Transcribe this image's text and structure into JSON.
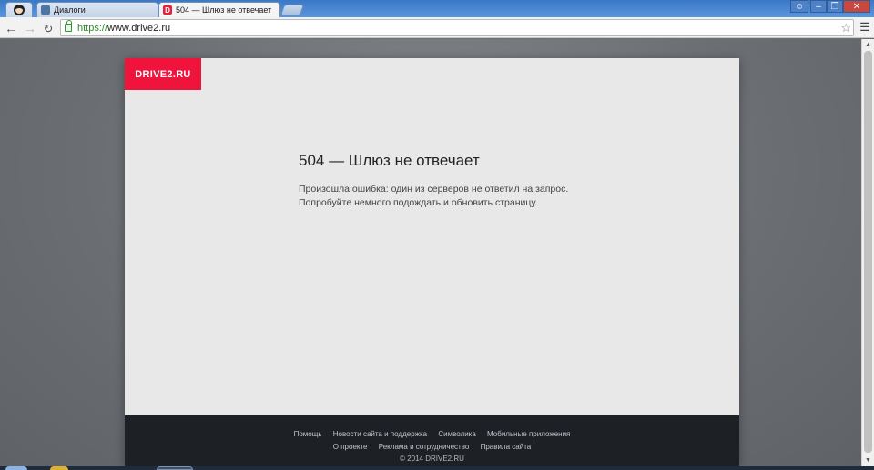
{
  "browser": {
    "tabs": [
      {
        "label": "Диалоги",
        "favicon": "vk-icon",
        "active": false
      },
      {
        "label": "504 — Шлюз не отвечает",
        "favicon": "drive2-icon",
        "active": true
      }
    ],
    "url": {
      "scheme": "https://",
      "host": "www.drive2.ru"
    }
  },
  "page": {
    "logo": "DRIVE2.RU",
    "error_title": "504 — Шлюз не отвечает",
    "error_line1": "Произошла ошибка: один из серверов не ответил на запрос.",
    "error_line2": "Попробуйте немного подождать и обновить страницу.",
    "footer": {
      "row1": [
        "Помощь",
        "Новости сайта и поддержка",
        "Символика",
        "Мобильные приложения"
      ],
      "row2": [
        "О проекте",
        "Реклама и сотрудничество",
        "Правила сайта"
      ],
      "copyright": "© 2014 DRIVE2.RU"
    }
  },
  "colors": {
    "brand": "#f0143c",
    "footer_bg": "#1d2126",
    "page_bg": "#e8e8e8",
    "titlebar": "#3a78c6"
  }
}
